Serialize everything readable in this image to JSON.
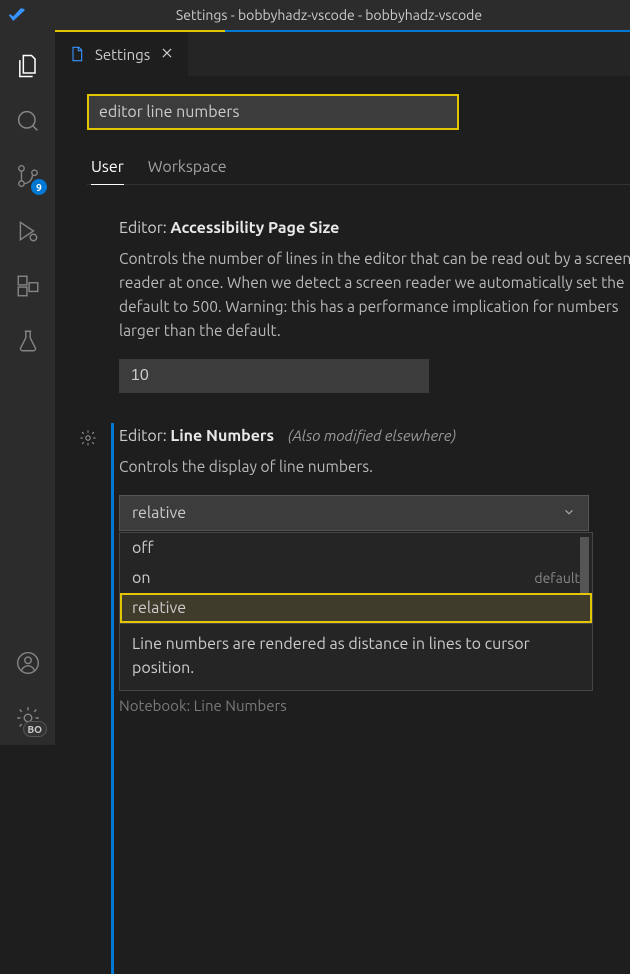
{
  "titlebar": {
    "title": "Settings - bobbyhadz-vscode - bobbyhadz-vscode"
  },
  "activitybar": {
    "scm_badge": "9",
    "bottom_badge": "BO"
  },
  "tab": {
    "label": "Settings"
  },
  "search": {
    "value": "editor line numbers"
  },
  "scope": {
    "user": "User",
    "workspace": "Workspace"
  },
  "settings": {
    "accessibility": {
      "prefix": "Editor: ",
      "name": "Accessibility Page Size",
      "desc": "Controls the number of lines in the editor that can be read out by a screen reader at once. When we detect a screen reader we automatically set the default to 500. Warning: this has a performance implication for numbers larger than the default.",
      "value": "10"
    },
    "lineNumbers": {
      "prefix": "Editor: ",
      "name": "Line Numbers",
      "alsoModified": "(Also modified elsewhere)",
      "desc": "Controls the display of line numbers.",
      "value": "relative",
      "options": {
        "off": "off",
        "on": "on",
        "relative": "relative",
        "default_tag": "default"
      },
      "optionDesc": "Line numbers are rendered as distance in lines to cursor position."
    },
    "notebook": {
      "truncated": "Notebook: Line Numbers"
    }
  }
}
